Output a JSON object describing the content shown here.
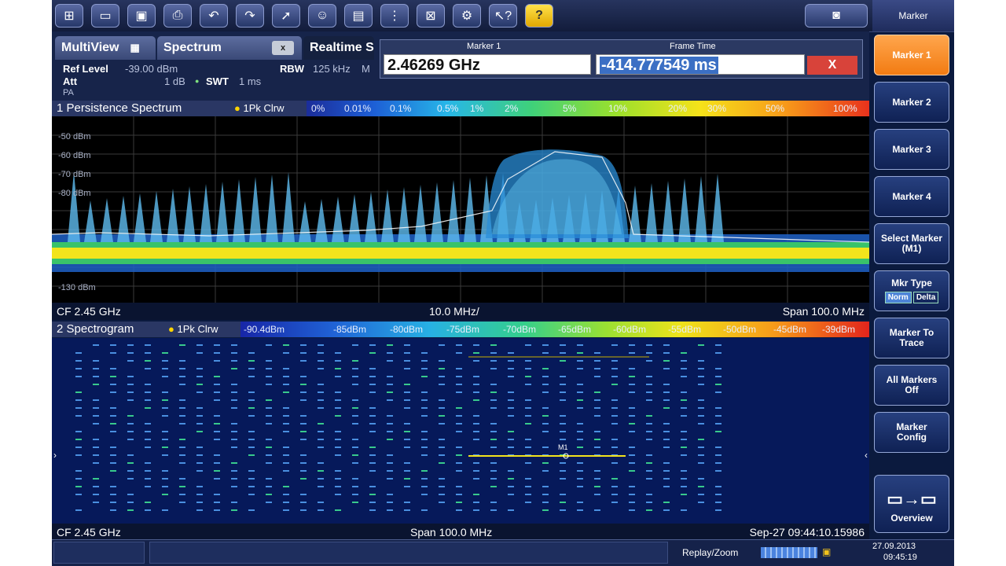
{
  "toolbar": {
    "buttons": [
      "windows-icon",
      "open-icon",
      "save-icon",
      "print-icon",
      "undo-icon",
      "redo-icon",
      "select-icon",
      "user-icon",
      "doc-edit-icon",
      "marker-user-icon",
      "layout-icon",
      "settings-icon",
      "help-pointer-icon",
      "help-icon"
    ],
    "camera_icon": "camera-icon",
    "softkey_title": "Marker"
  },
  "tabs": {
    "multiview": "MultiView",
    "spectrum": "Spectrum",
    "realtime": "Realtime S",
    "close": "x"
  },
  "marker_dialog": {
    "marker_label": "Marker 1",
    "marker_value": "2.46269 GHz",
    "frame_time_label": "Frame Time",
    "frame_time_value": "-414.777549 ms",
    "close": "X"
  },
  "settings": {
    "ref_level_label": "Ref Level",
    "ref_level_value": "-39.00 dBm",
    "att_label": "Att",
    "att_value": "1 dB",
    "swt_label": "SWT",
    "swt_value": "1 ms",
    "pa_label": "PA",
    "rbw_label": "RBW",
    "rbw_value": "125 kHz",
    "m_label": "M"
  },
  "persistence": {
    "title": "1 Persistence Spectrum",
    "trace": "1Pk Clrw",
    "legend": [
      "0%",
      "0.01%",
      "0.1%",
      "0.5%",
      "1%",
      "2%",
      "5%",
      "10%",
      "20%",
      "30%",
      "50%",
      "100%"
    ],
    "y_labels": [
      "-50 dBm",
      "-60 dBm",
      "-70 dBm",
      "-80 dBm",
      "-130 dBm"
    ],
    "cf": "CF 2.45 GHz",
    "div": "10.0 MHz/",
    "span": "Span 100.0 MHz"
  },
  "spectrogram": {
    "title": "2 Spectrogram",
    "trace": "1Pk Clrw",
    "legend": [
      "-90.4dBm",
      "-85dBm",
      "-80dBm",
      "-75dBm",
      "-70dBm",
      "-65dBm",
      "-60dBm",
      "-55dBm",
      "-50dBm",
      "-45dBm",
      "-39dBm"
    ],
    "marker": "M1",
    "cf": "CF 2.45 GHz",
    "span": "Span 100.0 MHz",
    "timestamp": "Sep-27 09:44:10.15986"
  },
  "softkeys": {
    "marker1": "Marker 1",
    "marker2": "Marker 2",
    "marker3": "Marker 3",
    "marker4": "Marker 4",
    "select_marker": "Select Marker (M1)",
    "mkr_type": "Mkr Type",
    "mkr_type_norm": "Norm",
    "mkr_type_delta": "Delta",
    "marker_to_trace": "Marker To Trace",
    "all_markers_off": "All Markers Off",
    "marker_config": "Marker Config",
    "overview": "Overview"
  },
  "status": {
    "replay_zoom": "Replay/Zoom",
    "date": "27.09.2013",
    "time": "09:45:19"
  },
  "colors": {
    "active_softkey": "#f27b12",
    "panel_bg": "#0b1a3e",
    "spectrogram_bg": "#06195a"
  }
}
